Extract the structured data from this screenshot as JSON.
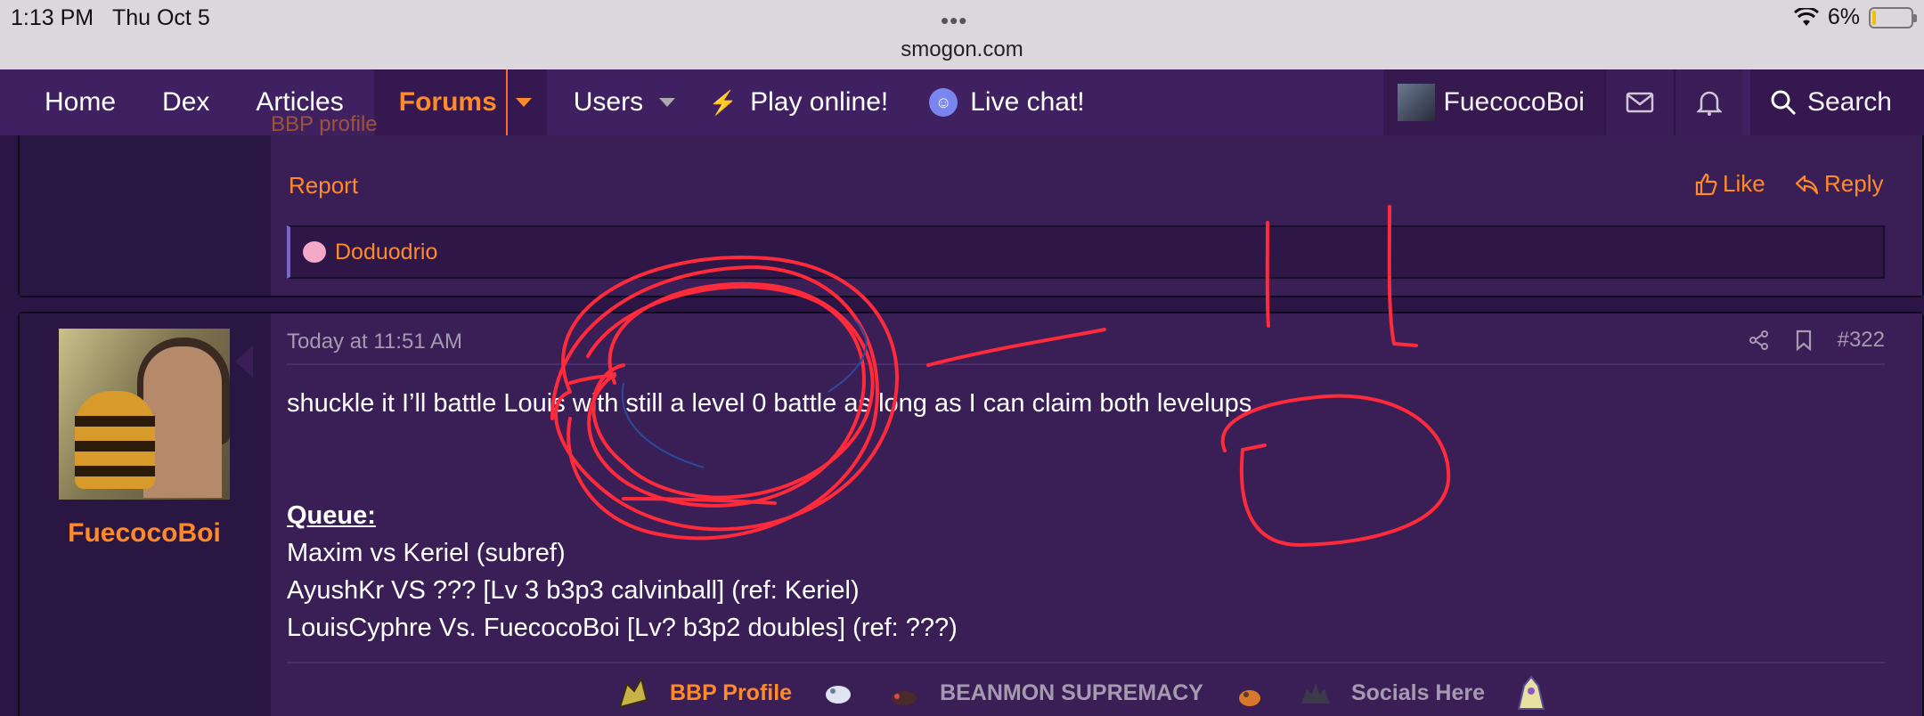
{
  "status_bar": {
    "time": "1:13 PM",
    "date": "Thu Oct 5",
    "dots": "•••",
    "url": "smogon.com",
    "battery": "6%",
    "battery_level": 0.06
  },
  "nav": {
    "items": [
      "Home",
      "Dex",
      "Articles",
      "Forums",
      "Users",
      "Play online!",
      "Live chat!"
    ],
    "user": "FuecocoBoi",
    "search": "Search"
  },
  "post_prev": {
    "partial_text": "BBP profile",
    "report": "Report",
    "like": "Like",
    "reply": "Reply",
    "reaction_user": "Doduodrio"
  },
  "post": {
    "timestamp": "Today at 11:51 AM",
    "number": "#322",
    "author": "FuecocoBoi",
    "body": "shuckle it I’ll battle Louis with still a level 0 battle as long as I can claim both levelups",
    "queue_title": "Queue:",
    "queue": [
      "Maxim vs Keriel (subref)",
      "AyushKr VS ??? [Lv 3 b3p3 calvinball] (ref: Keriel)",
      "LouisCyphre Vs. FuecocoBoi [Lv? b3p2 doubles] (ref: ???)"
    ],
    "signature": [
      "BBP Profile",
      "BEANMON SUPREMACY",
      "Socials Here"
    ]
  },
  "colors": {
    "accent": "#ff8a2a",
    "nav_bg": "#3f2161",
    "post_bg": "#3a1f57",
    "annotation": "#ff2a3a"
  }
}
